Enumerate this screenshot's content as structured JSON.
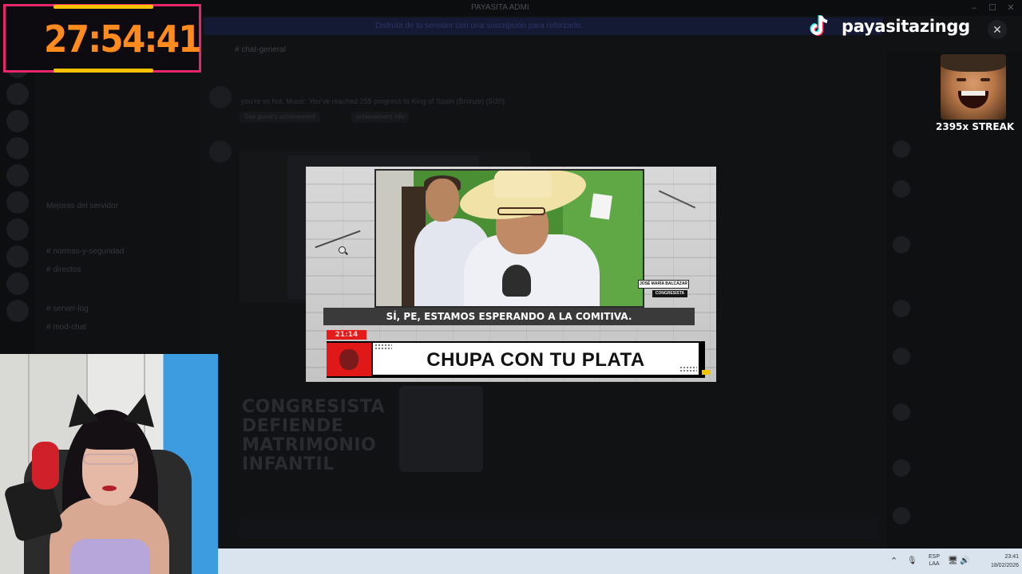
{
  "window": {
    "title": "PAYASITA ADMI",
    "minimize": "–",
    "maximize": "☐",
    "close": "✕"
  },
  "discord": {
    "banner_text": "Disfruta de tu servidor con una suscripción para reforzarlo.",
    "channel_header": "chat-general",
    "channels": [
      {
        "label": "Mejoras del servidor"
      },
      {
        "label": "normas-y-seguridad"
      },
      {
        "label": "directos"
      },
      {
        "label": "server-log"
      },
      {
        "label": "mod-chat"
      }
    ],
    "message": {
      "line1": "you're so hot. Music: You've reached 25$ progress to King of Spain (Bronze) (5/20)",
      "chips": [
        "See guest's achievement",
        "achievement info"
      ]
    },
    "background_headline": [
      "CONGRESISTA",
      "DEFIENDE",
      "MATRIMONIO",
      "INFANTIL"
    ]
  },
  "timer": {
    "value": "27:54:41"
  },
  "tiktok": {
    "handle": "payasitazingg",
    "close_symbol": "✕"
  },
  "streak": {
    "label": "2395x STREAK"
  },
  "video": {
    "subtitle": "SÍ, PE, ESTAMOS ESPERANDO A LA COMITIVA.",
    "name_tag": "JOSÉ MARÍA BALCÁZAR",
    "role_tag": "CONGRESISTA",
    "time_tag": "21:14",
    "headline": "CHUPA CON TU PLATA"
  },
  "taskbar": {
    "chevron": "⌃",
    "lang_line1": "ESP",
    "lang_line2": "LAA",
    "mic_icon": "🎙",
    "monitor_icon": "🖥",
    "speaker_icon": "🔊",
    "time": "23:41",
    "date": "18/02/2026"
  },
  "colors": {
    "timer_border": "#e6276a",
    "timer_digits": "#ff8a1e",
    "timer_accent": "#f7c100",
    "lower_third_red": "#e01818",
    "taskbar_bg": "#d9e4ee"
  }
}
